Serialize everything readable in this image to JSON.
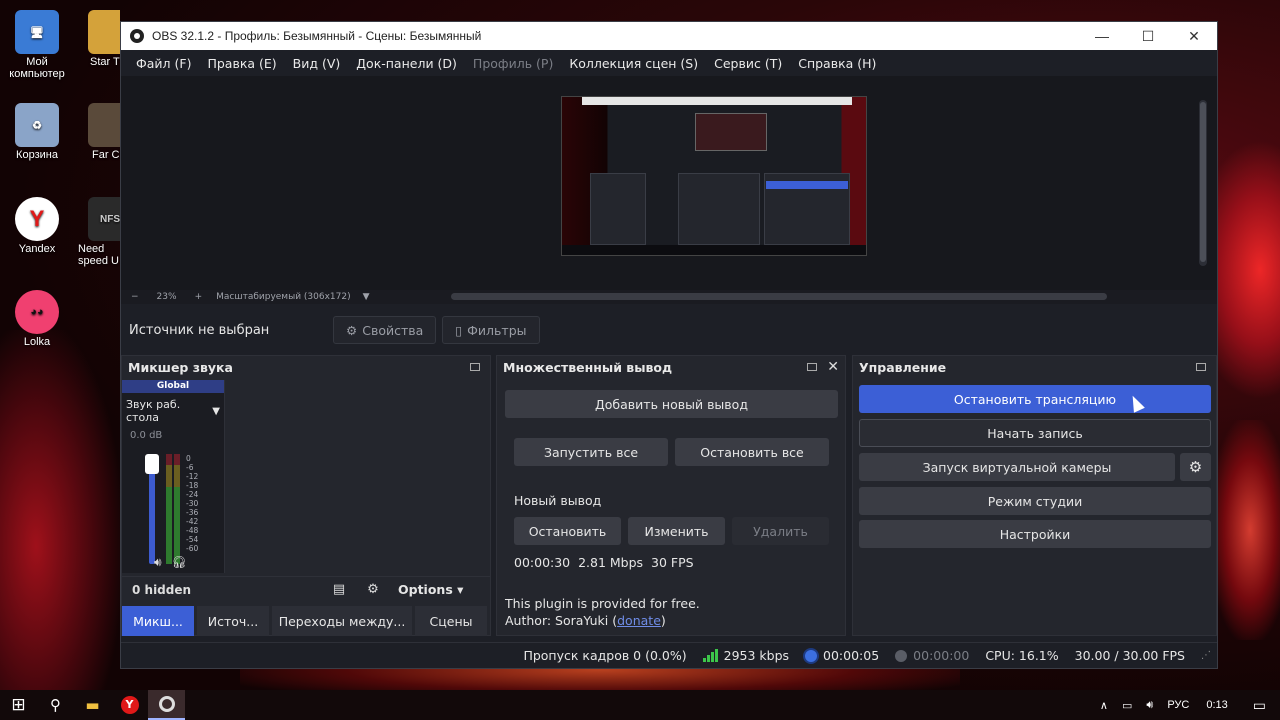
{
  "desktop": {
    "icons": [
      {
        "label": "Мой компьютер",
        "color": "#3a7bd5"
      },
      {
        "label": "Star T",
        "color": "#d4a23a"
      },
      {
        "label": "Корзина",
        "color": "#8aa4c8"
      },
      {
        "label": "Far C",
        "color": "#5a4a3a"
      },
      {
        "label": "Yandex",
        "color": "#ffffff"
      },
      {
        "label": "Need speed U",
        "color": "#2a2a2a"
      },
      {
        "label": "Lolka",
        "color": "#f04070"
      }
    ]
  },
  "window": {
    "title": "OBS 32.1.2 - Профиль: Безымянный - Сцены: Безымянный",
    "minimize": "—",
    "maximize": "☐",
    "close": "✕"
  },
  "menu": [
    "Файл (F)",
    "Правка (E)",
    "Вид (V)",
    "Док-панели (D)",
    "Профиль (P)",
    "Коллекция сцен (S)",
    "Сервис (T)",
    "Справка (H)"
  ],
  "zoom": {
    "minus": "−",
    "percent": "23%",
    "plus": "+",
    "mode": "Масштабируемый (306x172)"
  },
  "source_bar": {
    "no_source": "Источник не выбран",
    "properties": "Свойства",
    "filters": "Фильтры"
  },
  "mixer": {
    "title": "Микшер звука",
    "global": "Global",
    "device": "Звук раб. стола",
    "db": "0.0 dB",
    "ticks": [
      "0",
      "-6",
      "-12",
      "-18",
      "-24",
      "-30",
      "-36",
      "-42",
      "-48",
      "-54",
      "-60"
    ],
    "hidden": "0 hidden",
    "options": "Options"
  },
  "tabs": [
    "Микш...",
    "Источ...",
    "Переходы между...",
    "Сцены"
  ],
  "multi_output": {
    "title": "Множественный вывод",
    "add": "Добавить новый вывод",
    "start_all": "Запустить все",
    "stop_all": "Остановить все",
    "output_name": "Новый вывод",
    "stop": "Остановить",
    "edit": "Изменить",
    "delete": "Удалить",
    "time": "00:00:30",
    "bitrate": "2.81 Mbps",
    "fps": "30 FPS",
    "plugin_note": "This plugin is provided for free.",
    "author_prefix": "Author: SoraYuki (",
    "donate": "donate",
    "author_suffix": ")"
  },
  "controls": {
    "title": "Управление",
    "stop_stream": "Остановить трансляцию",
    "start_record": "Начать запись",
    "virtual_cam": "Запуск виртуальной камеры",
    "studio_mode": "Режим студии",
    "settings": "Настройки"
  },
  "status": {
    "dropped": "Пропуск кадров 0 (0.0%)",
    "kbps": "2953 kbps",
    "stream_time": "00:00:05",
    "record_time": "00:00:00",
    "cpu": "CPU: 16.1%",
    "fps": "30.00 / 30.00 FPS"
  },
  "taskbar": {
    "lang": "РУС",
    "time": "0:13"
  }
}
